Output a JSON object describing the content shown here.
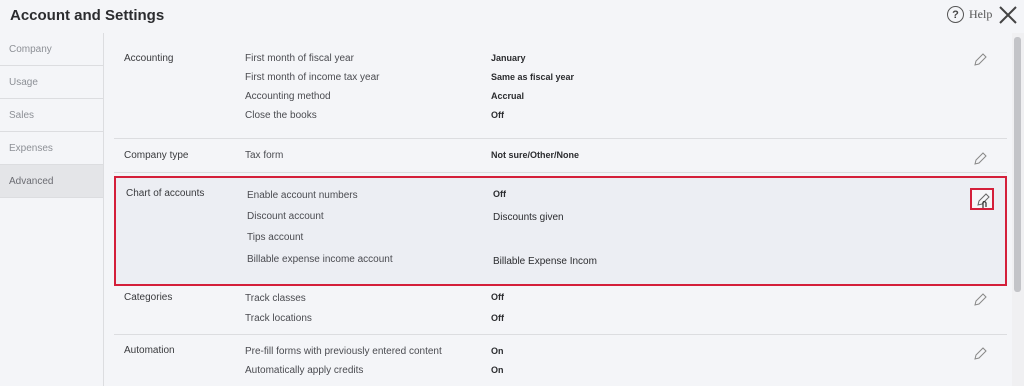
{
  "header": {
    "title": "Account and Settings",
    "help_label": "Help",
    "help_glyph": "?"
  },
  "sidebar": {
    "items": [
      {
        "label": "Company"
      },
      {
        "label": "Usage"
      },
      {
        "label": "Sales"
      },
      {
        "label": "Expenses"
      },
      {
        "label": "Advanced",
        "active": true
      }
    ]
  },
  "sections": {
    "accounting": {
      "label": "Accounting",
      "rows": [
        {
          "label": "First month of fiscal year",
          "value": "January"
        },
        {
          "label": "First month of income tax year",
          "value": "Same as fiscal year"
        },
        {
          "label": "Accounting method",
          "value": "Accrual"
        },
        {
          "label": "Close the books",
          "value": "Off"
        }
      ]
    },
    "company_type": {
      "label": "Company type",
      "rows": [
        {
          "label": "Tax form",
          "value": "Not sure/Other/None"
        }
      ]
    },
    "chart_of_accounts": {
      "label": "Chart of accounts",
      "rows": [
        {
          "label": "Enable account numbers",
          "value": "Off"
        },
        {
          "label": "Discount account",
          "value": "Discounts given"
        },
        {
          "label": "Tips account",
          "value": ""
        },
        {
          "label": "Billable expense income account",
          "value": "Billable Expense Incom"
        }
      ]
    },
    "categories": {
      "label": "Categories",
      "rows": [
        {
          "label": "Track classes",
          "value": "Off"
        },
        {
          "label": "Track locations",
          "value": "Off"
        }
      ]
    },
    "automation": {
      "label": "Automation",
      "rows": [
        {
          "label": "Pre-fill forms with previously entered content",
          "value": "On"
        },
        {
          "label": "Automatically apply credits",
          "value": "On"
        }
      ]
    }
  },
  "colors": {
    "highlight": "#d41f3a",
    "background": "#f4f5f8"
  }
}
